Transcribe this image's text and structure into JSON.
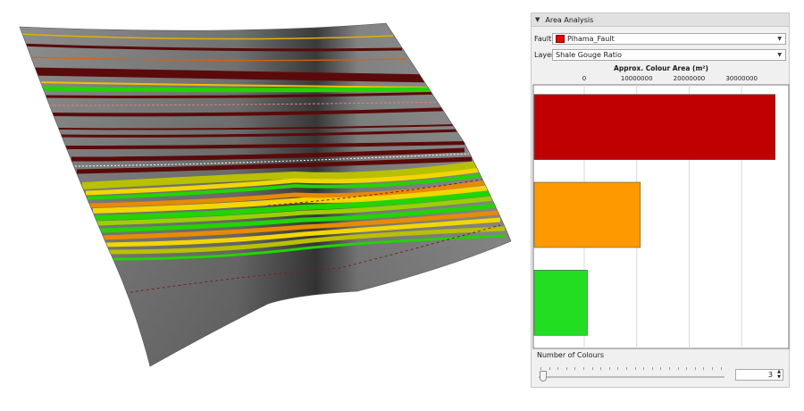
{
  "panel": {
    "title": "Area Analysis",
    "fault_label": "Fault:",
    "fault_value": "Pihama_Fault",
    "fault_swatch_color": "#ee0000",
    "layer_label": "Layer:",
    "layer_value": "Shale Gouge Ratio",
    "number_of_colours_label": "Number of Colours",
    "number_of_colours_value": "3"
  },
  "chart_data": {
    "type": "bar",
    "orientation": "horizontal",
    "title": "Approx. Colour Area (m²)",
    "xlabel": "",
    "ylabel": "",
    "xlim": [
      0,
      39000000
    ],
    "x_ticks": [
      0,
      10000000,
      20000000,
      30000000
    ],
    "x_tick_labels": [
      "0",
      "10000000",
      "20000000",
      "30000000"
    ],
    "grid": true,
    "series": [
      {
        "values": [
          36400000,
          10700000,
          600000
        ],
        "colors": [
          "#c00000",
          "#ff9900",
          "#22dd22"
        ]
      }
    ]
  },
  "viewport": {
    "colors": {
      "surface": "#878787",
      "dark_band": "#5a0a0a",
      "green": "#22d400",
      "yellow": "#f2d600",
      "orange": "#e88a00"
    }
  }
}
